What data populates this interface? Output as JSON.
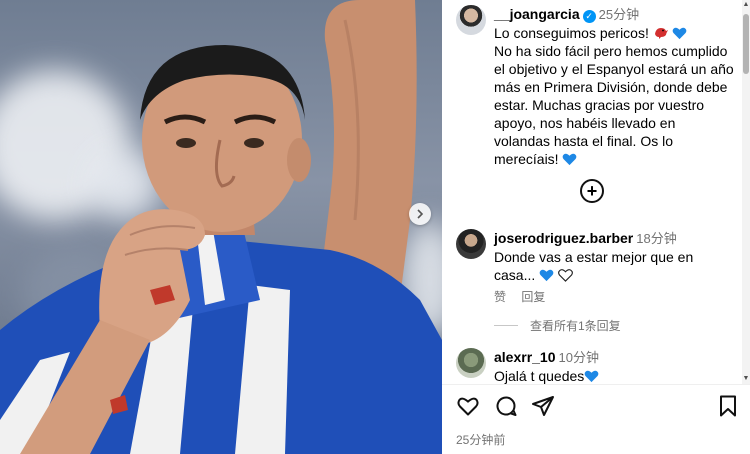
{
  "post": {
    "username": "__joangarcia",
    "time": "25分钟",
    "caption": {
      "line1": "Lo conseguimos pericos!",
      "body": "No ha sido fácil pero hemos cumplido el objetivo y el Espanyol estará un año más en Primera División, donde debe estar. Muchas gracias por vuestro apoyo, nos habéis llevado en volandas hasta el final. Os lo merecíais!"
    },
    "posted_ago": "25分钟前"
  },
  "comments": [
    {
      "username": "joserodriguez.barber",
      "time": "18分钟",
      "text": "Donde vas a estar mejor que en casa...",
      "like_label": "赞",
      "reply_label": "回复",
      "view_replies": "查看所有1条回复"
    },
    {
      "username": "alexrr_10",
      "time": "10分钟",
      "text": "Ojalá t quedes"
    }
  ],
  "icons": {
    "verified": "verified-badge-icon",
    "bird": "red-bird-icon",
    "heart_blue": "blue-heart-icon",
    "heart_white": "white-heart-icon",
    "add": "add-circle-icon",
    "next": "chevron-right-icon",
    "like": "heart-outline-icon",
    "comment": "comment-bubble-icon",
    "share": "paper-plane-icon",
    "save": "bookmark-icon"
  },
  "colors": {
    "verified": "#0095f6",
    "heart": "#1e88e5",
    "bird": "#d32f2f",
    "muted": "#737373"
  }
}
